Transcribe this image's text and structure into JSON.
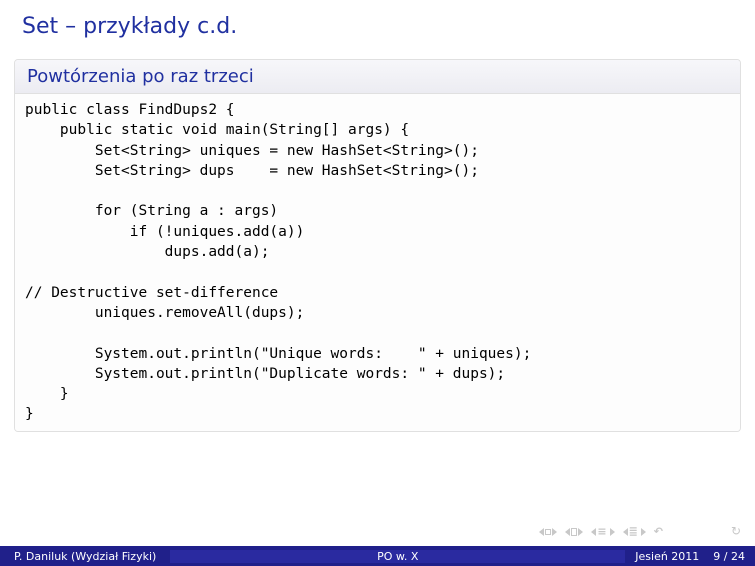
{
  "title": "Set – przykłady c.d.",
  "block": {
    "title": "Powtórzenia po raz trzeci",
    "code": "public class FindDups2 {\n    public static void main(String[] args) {\n        Set<String> uniques = new HashSet<String>();\n        Set<String> dups    = new HashSet<String>();\n\n        for (String a : args)\n            if (!uniques.add(a))\n                dups.add(a);\n\n// Destructive set-difference\n        uniques.removeAll(dups);\n\n        System.out.println(\"Unique words:    \" + uniques);\n        System.out.println(\"Duplicate words: \" + dups);\n    }\n}"
  },
  "footer": {
    "author": "P. Daniluk (Wydział Fizyki)",
    "course": "PO w. X",
    "term": "Jesień 2011",
    "page": "9 / 24"
  }
}
